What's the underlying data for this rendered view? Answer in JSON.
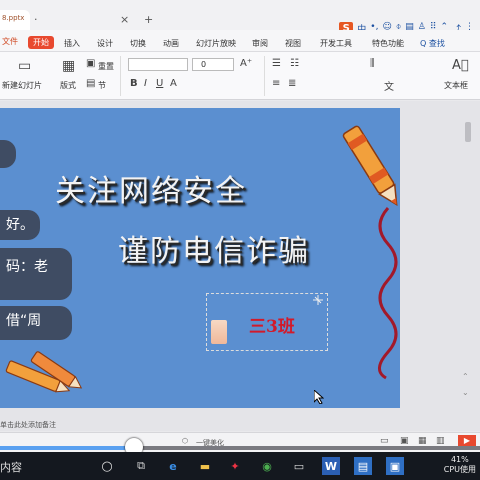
{
  "titlebar": {
    "doc_tab": "8.pptx",
    "close_glyph": "×",
    "new_tab_glyph": "+",
    "sogou_label": "S",
    "sogou_lang": "中",
    "colors": {
      "accent": "#e8492f",
      "sogou": "#e65722"
    }
  },
  "menubar": {
    "app_menu": "文件",
    "items": [
      "开始",
      "插入",
      "设计",
      "切换",
      "动画",
      "幻灯片放映",
      "审阅",
      "视图",
      "开发工具",
      "特色功能"
    ],
    "active_index": 0,
    "search_label": "Q 查找"
  },
  "ribbon": {
    "new_slide": "新建幻灯片",
    "layout": "版式",
    "section": "节",
    "reset": "重置",
    "font_size_value": "0",
    "text_direction": "文",
    "textbox": "文本框"
  },
  "slide": {
    "title_line1": "关注网络安全",
    "title_line2": "谨防电信诈骗",
    "class_label": "三3班",
    "colors": {
      "background": "#5b8fd0",
      "class_text": "#d21a2a"
    }
  },
  "chat_overlay": {
    "bubbles": [
      "",
      "好。",
      "码：老",
      "",
      "借“周"
    ]
  },
  "statusbar": {
    "note": "单击此处添加备注",
    "beautify": "一键美化"
  },
  "video": {
    "progress": 0.28
  },
  "taskbar": {
    "label": "内容",
    "cpu_percent": "41%",
    "cpu_label": "CPU使用"
  }
}
